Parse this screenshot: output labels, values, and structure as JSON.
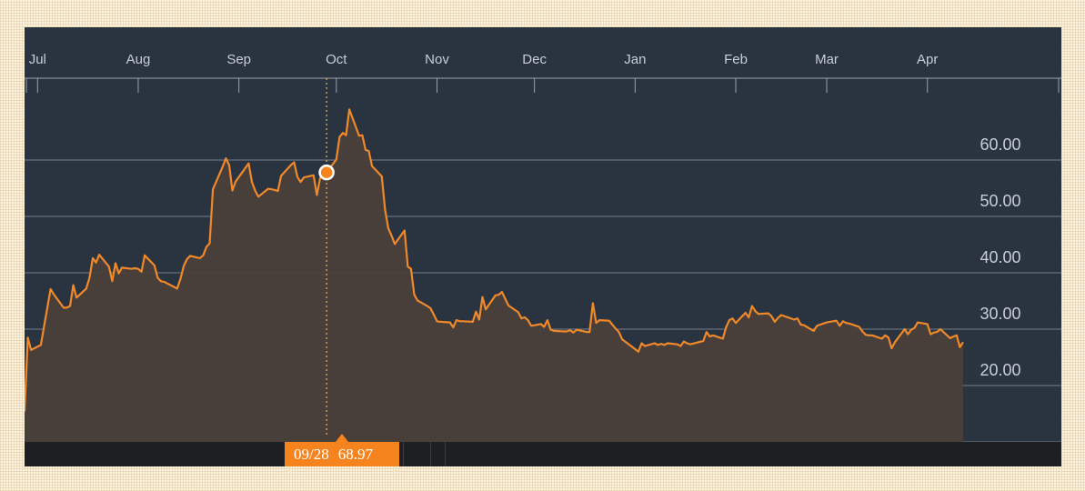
{
  "colors": {
    "background": "#2a3441",
    "line": "#f0892a",
    "fill": "#4a3f3a",
    "grid": "#8a9099",
    "crosshair": "#f5b942",
    "tooltip": "#f5841f",
    "bottom_bar": "#1d1f22"
  },
  "tooltip": {
    "date": "09/28",
    "value": "68.97"
  },
  "chart_data": {
    "type": "area",
    "x_tick_labels": [
      "Jul",
      "Aug",
      "Sep",
      "Oct",
      "Nov",
      "Dec",
      "Jan",
      "Feb",
      "Mar",
      "Apr"
    ],
    "y_tick_labels": [
      "20.00",
      "30.00",
      "40.00",
      "50.00",
      "60.00"
    ],
    "y_ticks": [
      20,
      30,
      40,
      50,
      60
    ],
    "ylim": [
      10,
      70
    ],
    "grid": true,
    "highlight": {
      "date": "09/28",
      "value": 68.97
    },
    "x": [
      "06-27",
      "06-28",
      "06-29",
      "07-02",
      "07-05",
      "07-06",
      "07-09",
      "07-10",
      "07-11",
      "07-12",
      "07-13",
      "07-16",
      "07-17",
      "07-18",
      "07-19",
      "07-20",
      "07-23",
      "07-24",
      "07-25",
      "07-26",
      "07-27",
      "07-30",
      "07-31",
      "08-01",
      "08-02",
      "08-03",
      "08-06",
      "08-07",
      "08-08",
      "08-09",
      "08-10",
      "08-13",
      "08-14",
      "08-15",
      "08-16",
      "08-17",
      "08-20",
      "08-21",
      "08-22",
      "08-23",
      "08-24",
      "08-27",
      "08-28",
      "08-29",
      "08-30",
      "08-31",
      "09-04",
      "09-05",
      "09-06",
      "09-07",
      "09-10",
      "09-11",
      "09-12",
      "09-13",
      "09-14",
      "09-17",
      "09-18",
      "09-19",
      "09-20",
      "09-21",
      "09-24",
      "09-25",
      "09-26",
      "09-27",
      "09-28",
      "10-01",
      "10-02",
      "10-03",
      "10-04",
      "10-05",
      "10-08",
      "10-09",
      "10-10",
      "10-11",
      "10-12",
      "10-15",
      "10-16",
      "10-17",
      "10-18",
      "10-19",
      "10-22",
      "10-23",
      "10-24",
      "10-25",
      "10-26",
      "10-29",
      "10-30",
      "10-31",
      "11-01",
      "11-02",
      "11-05",
      "11-06",
      "11-07",
      "11-08",
      "11-09",
      "11-12",
      "11-13",
      "11-14",
      "11-15",
      "11-16",
      "11-19",
      "11-20",
      "11-21",
      "11-23",
      "11-26",
      "11-27",
      "11-28",
      "11-29",
      "11-30",
      "12-03",
      "12-04",
      "12-05",
      "12-06",
      "12-07",
      "12-10",
      "12-11",
      "12-12",
      "12-13",
      "12-14",
      "12-17",
      "12-18",
      "12-19",
      "12-20",
      "12-21",
      "12-24",
      "12-26",
      "12-27",
      "12-28",
      "12-31",
      "01-02",
      "01-03",
      "01-04",
      "01-07",
      "01-08",
      "01-09",
      "01-10",
      "01-11",
      "01-14",
      "01-15",
      "01-16",
      "01-17",
      "01-18",
      "01-22",
      "01-23",
      "01-24",
      "01-25",
      "01-28",
      "01-29",
      "01-30",
      "01-31",
      "02-01",
      "02-04",
      "02-05",
      "02-06",
      "02-07",
      "02-08",
      "02-11",
      "02-12",
      "02-13",
      "02-14",
      "02-15",
      "02-19",
      "02-20",
      "02-21",
      "02-22",
      "02-25",
      "02-26",
      "02-27",
      "02-28",
      "03-01",
      "03-04",
      "03-05",
      "03-06",
      "03-07",
      "03-08",
      "03-11",
      "03-12",
      "03-13",
      "03-14",
      "03-15",
      "03-18",
      "03-19",
      "03-20",
      "03-21",
      "03-22",
      "03-25",
      "03-26",
      "03-27",
      "03-28",
      "03-29",
      "04-01",
      "04-02",
      "04-03",
      "04-04",
      "04-05",
      "04-08",
      "04-09",
      "04-10",
      "04-11",
      "04-12"
    ],
    "y": [
      15.4,
      28.5,
      26.3,
      27.2,
      37.1,
      36.2,
      33.8,
      33.8,
      34.1,
      37.8,
      35.6,
      37.2,
      39.1,
      42.6,
      41.8,
      43.2,
      41.1,
      38.5,
      41.7,
      39.9,
      40.9,
      40.7,
      40.8,
      40.7,
      40.2,
      43.1,
      41.3,
      39.1,
      38.5,
      38.4,
      38.1,
      37.2,
      38.9,
      41.2,
      42.4,
      43.0,
      42.6,
      43.1,
      44.6,
      45.2,
      54.8,
      58.8,
      60.3,
      59.1,
      54.6,
      56.2,
      59.4,
      56.1,
      54.6,
      53.5,
      54.9,
      54.8,
      54.7,
      54.5,
      57.2,
      59.1,
      59.6,
      57.0,
      56.1,
      56.9,
      57.3,
      53.8,
      56.8,
      58.0,
      57.8,
      60.1,
      64.1,
      64.8,
      64.4,
      68.97,
      64.3,
      64.4,
      61.8,
      61.6,
      58.9,
      57.1,
      51.2,
      47.9,
      46.6,
      45.1,
      47.5,
      41.1,
      40.7,
      36.1,
      35.1,
      34.1,
      33.7,
      32.6,
      31.4,
      31.3,
      31.2,
      30.3,
      31.6,
      31.4,
      31.4,
      31.3,
      33.1,
      31.7,
      35.7,
      33.5,
      36.0,
      36.1,
      36.6,
      34.2,
      33.0,
      31.9,
      32.1,
      31.6,
      30.6,
      30.9,
      30.4,
      31.6,
      29.9,
      29.7,
      29.6,
      29.6,
      29.8,
      29.4,
      29.9,
      29.5,
      29.5,
      34.6,
      31.1,
      31.6,
      31.5,
      30.1,
      29.5,
      28.2,
      26.9,
      26.0,
      27.5,
      27.0,
      27.5,
      27.2,
      27.4,
      27.2,
      27.5,
      27.3,
      27.0,
      27.8,
      27.5,
      27.3,
      27.9,
      29.5,
      28.7,
      28.9,
      28.3,
      30.3,
      31.6,
      31.9,
      31.1,
      32.9,
      32.1,
      34.1,
      33.2,
      32.7,
      32.8,
      32.3,
      31.3,
      32.0,
      32.5,
      31.7,
      31.9,
      30.8,
      30.7,
      29.7,
      30.6,
      30.8,
      31.0,
      31.2,
      31.5,
      30.6,
      31.4,
      31.1,
      31.0,
      30.4,
      29.6,
      29.0,
      28.9,
      28.9,
      28.3,
      28.9,
      28.5,
      26.6,
      27.7,
      30.0,
      29.1,
      29.9,
      30.2,
      31.2,
      30.9,
      29.1,
      29.4,
      29.5,
      30.0,
      28.4,
      28.7,
      28.9,
      26.8,
      27.7
    ]
  }
}
